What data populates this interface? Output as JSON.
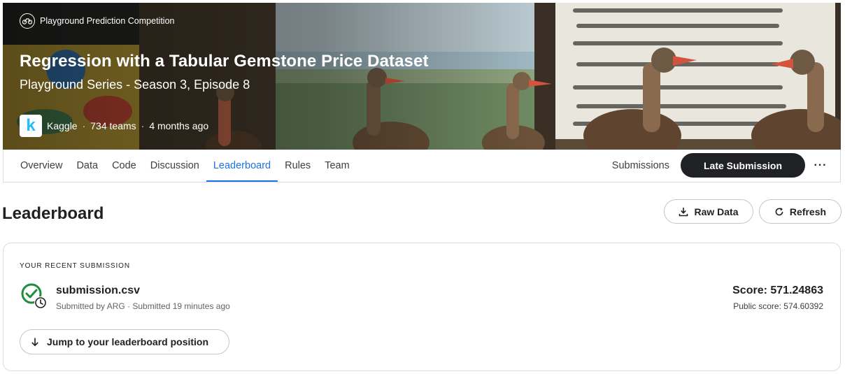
{
  "banner": {
    "competition_type": "Playground Prediction Competition",
    "title": "Regression with a Tabular Gemstone Price Dataset",
    "subtitle": "Playground Series - Season 3, Episode 8",
    "host": "Kaggle",
    "teams": "734 teams",
    "age": "4 months ago",
    "separator": "·",
    "logo_letter": "k"
  },
  "nav": {
    "tabs": [
      {
        "label": "Overview"
      },
      {
        "label": "Data"
      },
      {
        "label": "Code"
      },
      {
        "label": "Discussion"
      },
      {
        "label": "Leaderboard",
        "active": true
      },
      {
        "label": "Rules"
      },
      {
        "label": "Team"
      }
    ],
    "submissions_label": "Submissions",
    "late_submission_label": "Late Submission",
    "more_label": "···"
  },
  "leaderboard": {
    "title": "Leaderboard",
    "raw_data_label": "Raw Data",
    "refresh_label": "Refresh"
  },
  "recent_submission": {
    "section_label": "YOUR RECENT SUBMISSION",
    "file_name": "submission.csv",
    "submitted_line": "Submitted by ARG · Submitted 19 minutes ago",
    "score": "Score: 571.24863",
    "public_score": "Public score: 574.60392",
    "jump_label": "Jump to your leaderboard position"
  },
  "colors": {
    "accent": "#1a73e8",
    "dark_button": "#202124",
    "success": "#1e8e3e",
    "kaggle_blue": "#20beff"
  }
}
